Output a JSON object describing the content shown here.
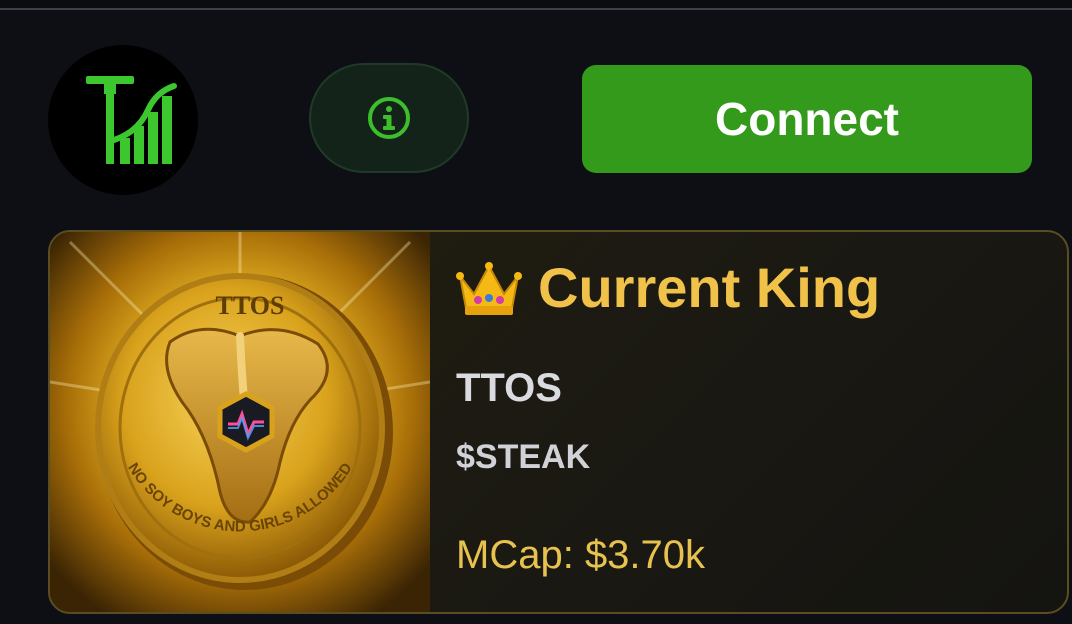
{
  "header": {
    "logo_icon": "chart-growth-logo-icon",
    "info_icon": "info-icon",
    "connect_label": "Connect"
  },
  "king": {
    "crown_icon": "crown-icon",
    "title": "Current King",
    "name": "TTOS",
    "ticker": "$STEAK",
    "mcap_label": "MCap:",
    "mcap_value": "$3.70k",
    "coin": {
      "top_text": "TTOS",
      "rim_text": "NO SOY BOYS AND GIRLS ALLOWED"
    }
  },
  "colors": {
    "background": "#0e0f14",
    "brand_green": "#349a1c",
    "gold": "#f1c24a"
  }
}
